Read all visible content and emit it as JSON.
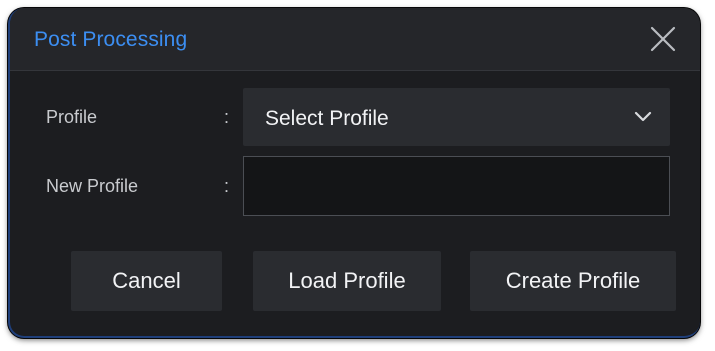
{
  "dialog": {
    "title": "Post Processing",
    "close_icon": "close-icon",
    "accent_color": "#3c8ef2"
  },
  "form": {
    "profile_label": "Profile",
    "separator": ":",
    "profile_select": {
      "selected_value": "Select Profile",
      "icon": "chevron-down-icon"
    },
    "new_profile_label": "New Profile",
    "new_profile_value": ""
  },
  "buttons": {
    "cancel": "Cancel",
    "load_profile": "Load Profile",
    "create_profile": "Create Profile"
  }
}
